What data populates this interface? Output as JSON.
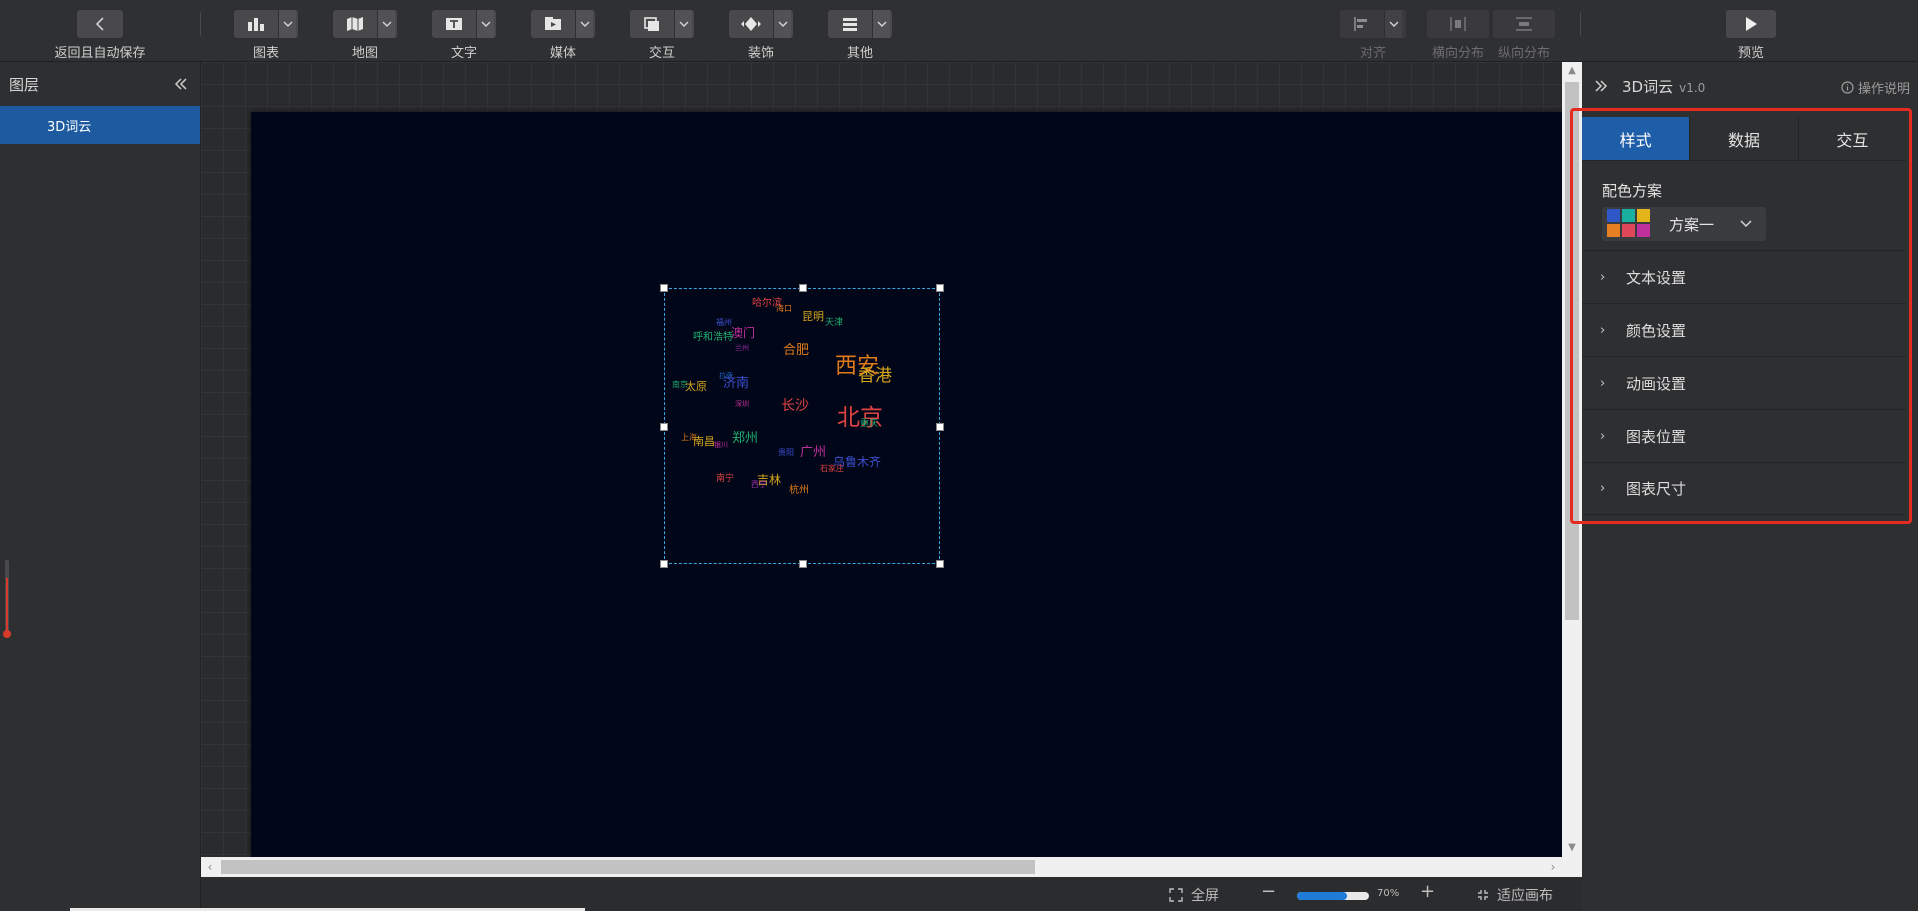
{
  "toolbar": {
    "back_label": "返回且自动保存",
    "groups": [
      {
        "label": "图表",
        "icon": "bar-chart-icon"
      },
      {
        "label": "地图",
        "icon": "map-icon"
      },
      {
        "label": "文字",
        "icon": "text-icon"
      },
      {
        "label": "媒体",
        "icon": "media-icon"
      },
      {
        "label": "交互",
        "icon": "interaction-icon"
      },
      {
        "label": "装饰",
        "icon": "decoration-icon"
      },
      {
        "label": "其他",
        "icon": "other-icon"
      }
    ],
    "align_label": "对齐",
    "hdist_label": "横向分布",
    "vdist_label": "纵向分布",
    "preview_label": "预览"
  },
  "layers": {
    "title": "图层",
    "items": [
      {
        "label": "3D词云",
        "selected": true
      }
    ]
  },
  "wordcloud": {
    "words": [
      {
        "text": "哈尔滨",
        "color": "#e04343"
      },
      {
        "text": "海口",
        "color": "#e07b1a"
      },
      {
        "text": "昆明",
        "color": "#d6a61c"
      },
      {
        "text": "天津",
        "color": "#1fae6e"
      },
      {
        "text": "福州",
        "color": "#3c4fd0"
      },
      {
        "text": "澳门",
        "color": "#c0309c"
      },
      {
        "text": "呼和浩特",
        "color": "#1fae6e"
      },
      {
        "text": "兰州",
        "color": "#9b2fa8"
      },
      {
        "text": "合肥",
        "color": "#e07b1a"
      },
      {
        "text": "西安",
        "color": "#e07b1a"
      },
      {
        "text": "香港",
        "color": "#d6a61c"
      },
      {
        "text": "拉萨",
        "color": "#1f67c8"
      },
      {
        "text": "南京",
        "color": "#1fae6e"
      },
      {
        "text": "太原",
        "color": "#d6a61c"
      },
      {
        "text": "济南",
        "color": "#3c4fd0"
      },
      {
        "text": "深圳",
        "color": "#c0309c"
      },
      {
        "text": "长沙",
        "color": "#e04343"
      },
      {
        "text": "北京",
        "color": "#e04343"
      },
      {
        "text": "重庆",
        "color": "#1fae6e"
      },
      {
        "text": "上海",
        "color": "#e07b1a"
      },
      {
        "text": "南昌",
        "color": "#d6a61c"
      },
      {
        "text": "银川",
        "color": "#c0309c"
      },
      {
        "text": "郑州",
        "color": "#1fae6e"
      },
      {
        "text": "贵阳",
        "color": "#3c4fd0"
      },
      {
        "text": "广州",
        "color": "#c0309c"
      },
      {
        "text": "乌鲁木齐",
        "color": "#3c4fd0"
      },
      {
        "text": "石家庄",
        "color": "#e04343"
      },
      {
        "text": "南宁",
        "color": "#e04343"
      },
      {
        "text": "吉林",
        "color": "#d6a61c"
      },
      {
        "text": "西宁",
        "color": "#9b2fa8"
      },
      {
        "text": "杭州",
        "color": "#e07b1a"
      }
    ]
  },
  "statusbar": {
    "fullscreen_label": "全屏",
    "zoom_percent": 70,
    "zoom_text": "70%",
    "fit_label": "适应画布"
  },
  "props": {
    "component_name": "3D词云",
    "version": "v1.0",
    "help_label": "操作说明",
    "tabs": [
      {
        "label": "样式",
        "active": true
      },
      {
        "label": "数据",
        "active": false
      },
      {
        "label": "交互",
        "active": false
      }
    ],
    "color_scheme_label": "配色方案",
    "color_scheme_value": "方案一",
    "swatches": [
      "#2f57c8",
      "#19b0a0",
      "#e3b51a",
      "#e67e22",
      "#e0485a",
      "#c0309c"
    ],
    "sections": [
      {
        "label": "文本设置"
      },
      {
        "label": "颜色设置"
      },
      {
        "label": "动画设置"
      },
      {
        "label": "图表位置"
      },
      {
        "label": "图表尺寸"
      }
    ]
  },
  "colors": {
    "accent": "#1e5ea8",
    "highlight": "#e52a22",
    "stage": "#010618"
  }
}
